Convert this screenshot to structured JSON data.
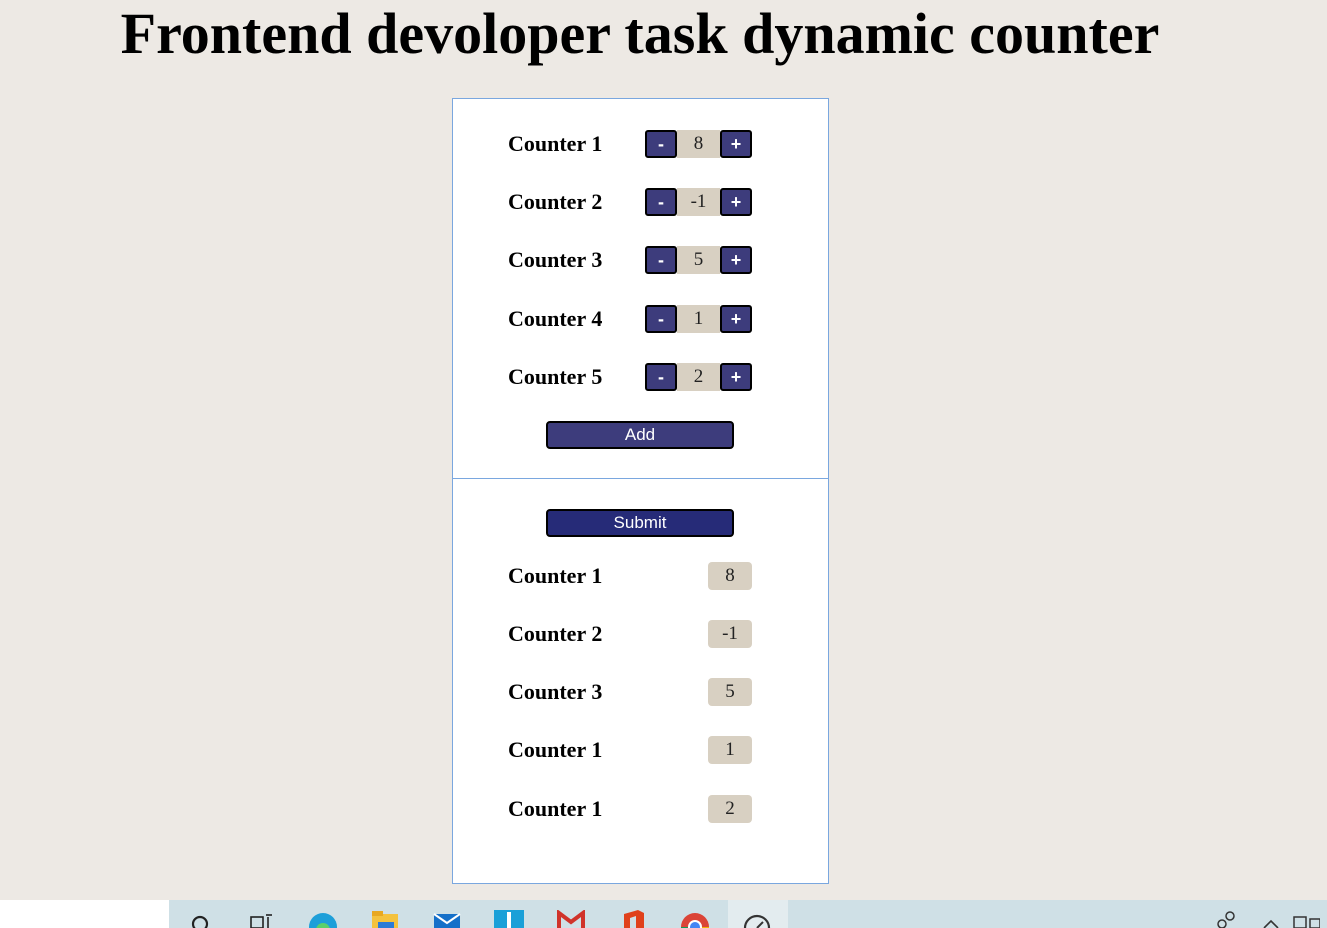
{
  "page_title": "Frontend devoloper task dynamic counter",
  "counters": [
    {
      "label": "Counter 1",
      "value": "8",
      "minus": "-",
      "plus": "+"
    },
    {
      "label": "Counter 2",
      "value": "-1",
      "minus": "-",
      "plus": "+"
    },
    {
      "label": "Counter 3",
      "value": "5",
      "minus": "-",
      "plus": "+"
    },
    {
      "label": "Counter 4",
      "value": "1",
      "minus": "-",
      "plus": "+"
    },
    {
      "label": "Counter 5",
      "value": "2",
      "minus": "-",
      "plus": "+"
    }
  ],
  "add_label": "Add",
  "submit_label": "Submit",
  "results": [
    {
      "label": "Counter 1",
      "value": "8"
    },
    {
      "label": "Counter 2",
      "value": "-1"
    },
    {
      "label": "Counter 3",
      "value": "5"
    },
    {
      "label": "Counter 1",
      "value": "1"
    },
    {
      "label": "Counter 1",
      "value": "2"
    }
  ],
  "colors": {
    "button": "#3d3c7c",
    "submit_button": "#262b78",
    "value_bg": "#d8d0c2",
    "page_bg": "#ede9e4",
    "panel_border": "#7aa7df"
  },
  "taskbar_icons": [
    "search-icon",
    "task-view-icon",
    "edge-icon",
    "file-explorer-icon",
    "mail-icon",
    "app-icon",
    "gmail-icon",
    "office-icon",
    "chrome-icon",
    "app-active-icon",
    "people-icon",
    "chevron-up-icon",
    "tray-icon"
  ]
}
